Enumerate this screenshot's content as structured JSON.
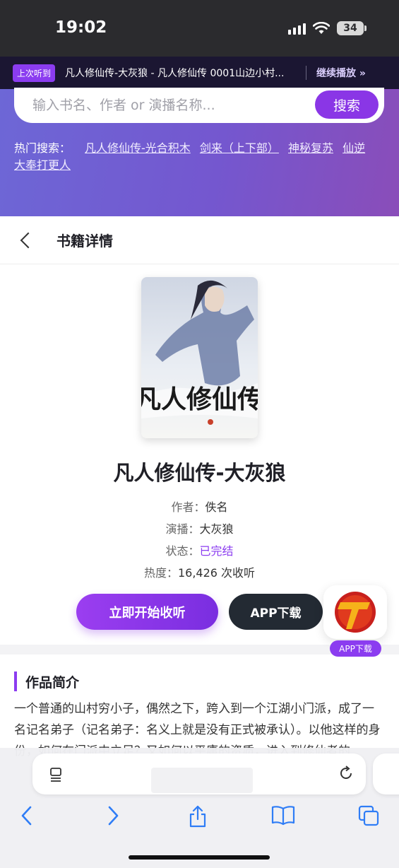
{
  "status_bar": {
    "time": "19:02",
    "battery": "34"
  },
  "resume_bar": {
    "badge": "上次听到",
    "title": "凡人修仙传-大灰狼 - 凡人修仙传 0001山边小村...",
    "continue": "继续播放 »"
  },
  "search": {
    "placeholder": "输入书名、作者 or 演播名称...",
    "button": "搜索"
  },
  "hot_search": {
    "label": "热门搜索：",
    "items": [
      "凡人修仙传-光合积木",
      "剑来（上下部）",
      "神秘复苏",
      "仙逆",
      "大奉打更人"
    ]
  },
  "header": {
    "title": "书籍详情"
  },
  "book": {
    "title": "凡人修仙传-大灰狼",
    "author_label": "作者：",
    "author": "佚名",
    "narrator_label": "演播：",
    "narrator": "大灰狼",
    "status_label": "状态：",
    "status": "已完结",
    "popularity_label": "热度：",
    "popularity": "16,426 次收听",
    "cover_text": "凡人修仙传"
  },
  "buttons": {
    "listen": "立即开始收听",
    "app": "APP下载"
  },
  "float_app": {
    "label": "APP下载"
  },
  "intro": {
    "title": "作品简介",
    "text": "一个普通的山村穷小子，偶然之下，跨入到一个江湖小门派，成了一名记名弟子（记名弟子：名义上就是没有正式被承认）。以他这样的身份，如何在门派中立足？又如何以平庸的资质，进入到修仙者的"
  },
  "colors": {
    "accent": "#8b3cf0",
    "dark": "#232a33"
  }
}
